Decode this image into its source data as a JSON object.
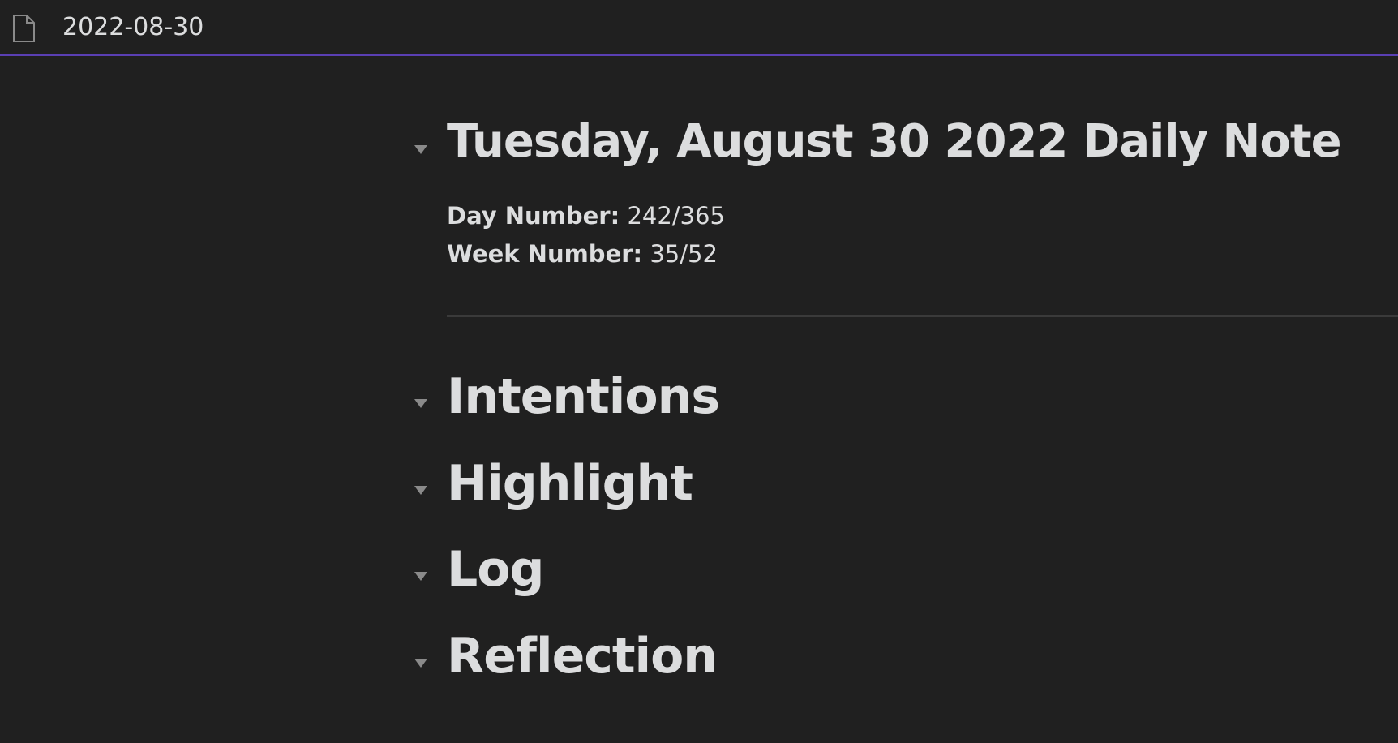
{
  "header": {
    "file_title": "2022-08-30",
    "file_icon": "document-icon"
  },
  "note": {
    "title": "Tuesday, August 30 2022 Daily Note",
    "day_number_label": "Day Number:",
    "day_number_value": "242/365",
    "week_number_label": "Week Number:",
    "week_number_value": "35/52",
    "sections": [
      {
        "label": "Intentions"
      },
      {
        "label": "Highlight"
      },
      {
        "label": "Log"
      },
      {
        "label": "Reflection"
      }
    ]
  },
  "colors": {
    "background": "#202020",
    "accent": "#5a3fb3",
    "text": "#dcddde",
    "muted": "#8a8a8a"
  }
}
